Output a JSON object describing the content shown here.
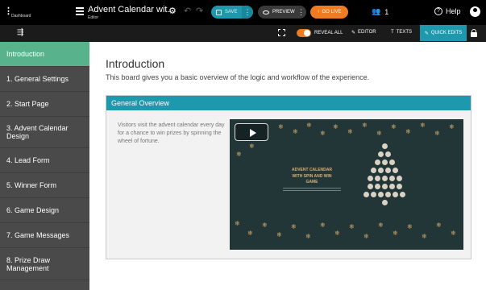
{
  "topbar": {
    "dashboard_label": "Dashboard",
    "title": "Advent Calendar wit...",
    "subtitle": "Editor",
    "save_label": "SAVE",
    "preview_label": "PREVIEW",
    "golive_label": "GO LIVE",
    "users_count": "1",
    "help_label": "Help"
  },
  "toolbar2": {
    "reveal_all_label": "REVEAL ALL",
    "editor_label": "EDITOR",
    "texts_label": "TEXTS",
    "quick_edits_label": "QUICK EDITS"
  },
  "sidebar": {
    "items": [
      {
        "label": "Introduction",
        "active": true
      },
      {
        "label": "1. General Settings",
        "active": false
      },
      {
        "label": "2. Start Page",
        "active": false
      },
      {
        "label": "3. Advent Calendar Design",
        "active": false
      },
      {
        "label": "4. Lead Form",
        "active": false
      },
      {
        "label": "5. Winner Form",
        "active": false
      },
      {
        "label": "6. Game Design",
        "active": false
      },
      {
        "label": "7. Game Messages",
        "active": false
      },
      {
        "label": "8. Prize Draw Management",
        "active": false
      }
    ]
  },
  "main": {
    "title": "Introduction",
    "description": "This board gives you a basic overview of the logic and workflow of the experience.",
    "panel_title": "General Overview",
    "panel_text": "Visitors visit the advent calendar every day for a chance to win prizes by spinning the wheel of fortune.",
    "video_title": "ADVENT CALENDAR WITH SPIN AND WIN GAME"
  },
  "colors": {
    "accent": "#1e98ad",
    "active_nav": "#58b28b",
    "go_live": "#f07b20",
    "sidebar_bg": "#4a4a4a",
    "video_bg": "#223638",
    "gold": "#c9a46a"
  }
}
